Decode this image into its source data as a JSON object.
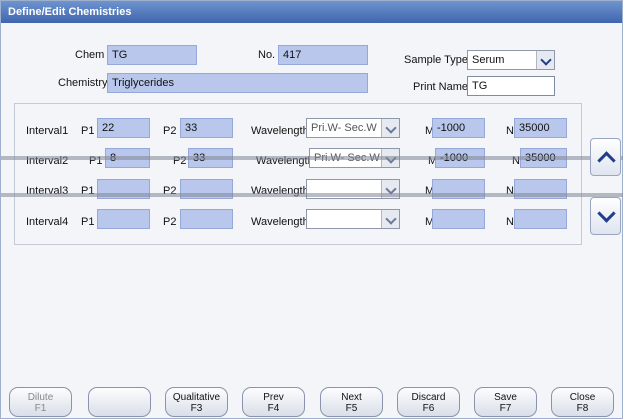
{
  "window": {
    "title": "Define/Edit Chemistries"
  },
  "header": {
    "chem_label": "Chem",
    "chem_value": "TG",
    "no_label": "No.",
    "no_value": "417",
    "sample_type_label": "Sample Type",
    "sample_type_value": "Serum",
    "chemistry_label": "Chemistry",
    "chemistry_value": "Triglycerides",
    "print_name_label": "Print Name",
    "print_name_value": "TG"
  },
  "intervals": [
    {
      "label": "Interval1",
      "p1_label": "P1",
      "p1": "22",
      "p2_label": "P2",
      "p2": "33",
      "wavelength_label": "Wavelength",
      "wavelength": "Pri.W- Sec.W",
      "m_label": "M",
      "m": "-1000",
      "n_label": "N",
      "n": "35000"
    },
    {
      "label": "Interval2",
      "p1_label": "P1",
      "p1": "8",
      "p2_label": "P2",
      "p2": "33",
      "wavelength_label": "Wavelength",
      "wavelength": "Pri.W- Sec.W",
      "m_label": "M",
      "m": "-1000",
      "n_label": "N",
      "n": "35000"
    },
    {
      "label": "Interval3",
      "p1_label": "P1",
      "p1": "",
      "p2_label": "P2",
      "p2": "",
      "wavelength_label": "Wavelength",
      "wavelength": "",
      "m_label": "M",
      "m": "",
      "n_label": "N",
      "n": ""
    },
    {
      "label": "Interval4",
      "p1_label": "P1",
      "p1": "",
      "p2_label": "P2",
      "p2": "",
      "wavelength_label": "Wavelength",
      "wavelength": "",
      "m_label": "M",
      "m": "",
      "n_label": "N",
      "n": ""
    }
  ],
  "scroll": {
    "up_icon": "chevron-up-icon",
    "down_icon": "chevron-down-icon"
  },
  "footer": {
    "keys": [
      {
        "label": "Dilute",
        "key": "F1",
        "enabled": false
      },
      {
        "label": "",
        "key": "",
        "enabled": true
      },
      {
        "label": "Qualitative",
        "key": "F3",
        "enabled": true
      },
      {
        "label": "Prev",
        "key": "F4",
        "enabled": true
      },
      {
        "label": "Next",
        "key": "F5",
        "enabled": true
      },
      {
        "label": "Discard",
        "key": "F6",
        "enabled": true
      },
      {
        "label": "Save",
        "key": "F7",
        "enabled": true
      },
      {
        "label": "Close",
        "key": "F8",
        "enabled": true
      }
    ]
  },
  "colors": {
    "title_bar": "#4a70b5",
    "field_fill": "#b9c7ec",
    "window_bg": "#f4f5f8",
    "accent": "#1f3e8c"
  }
}
